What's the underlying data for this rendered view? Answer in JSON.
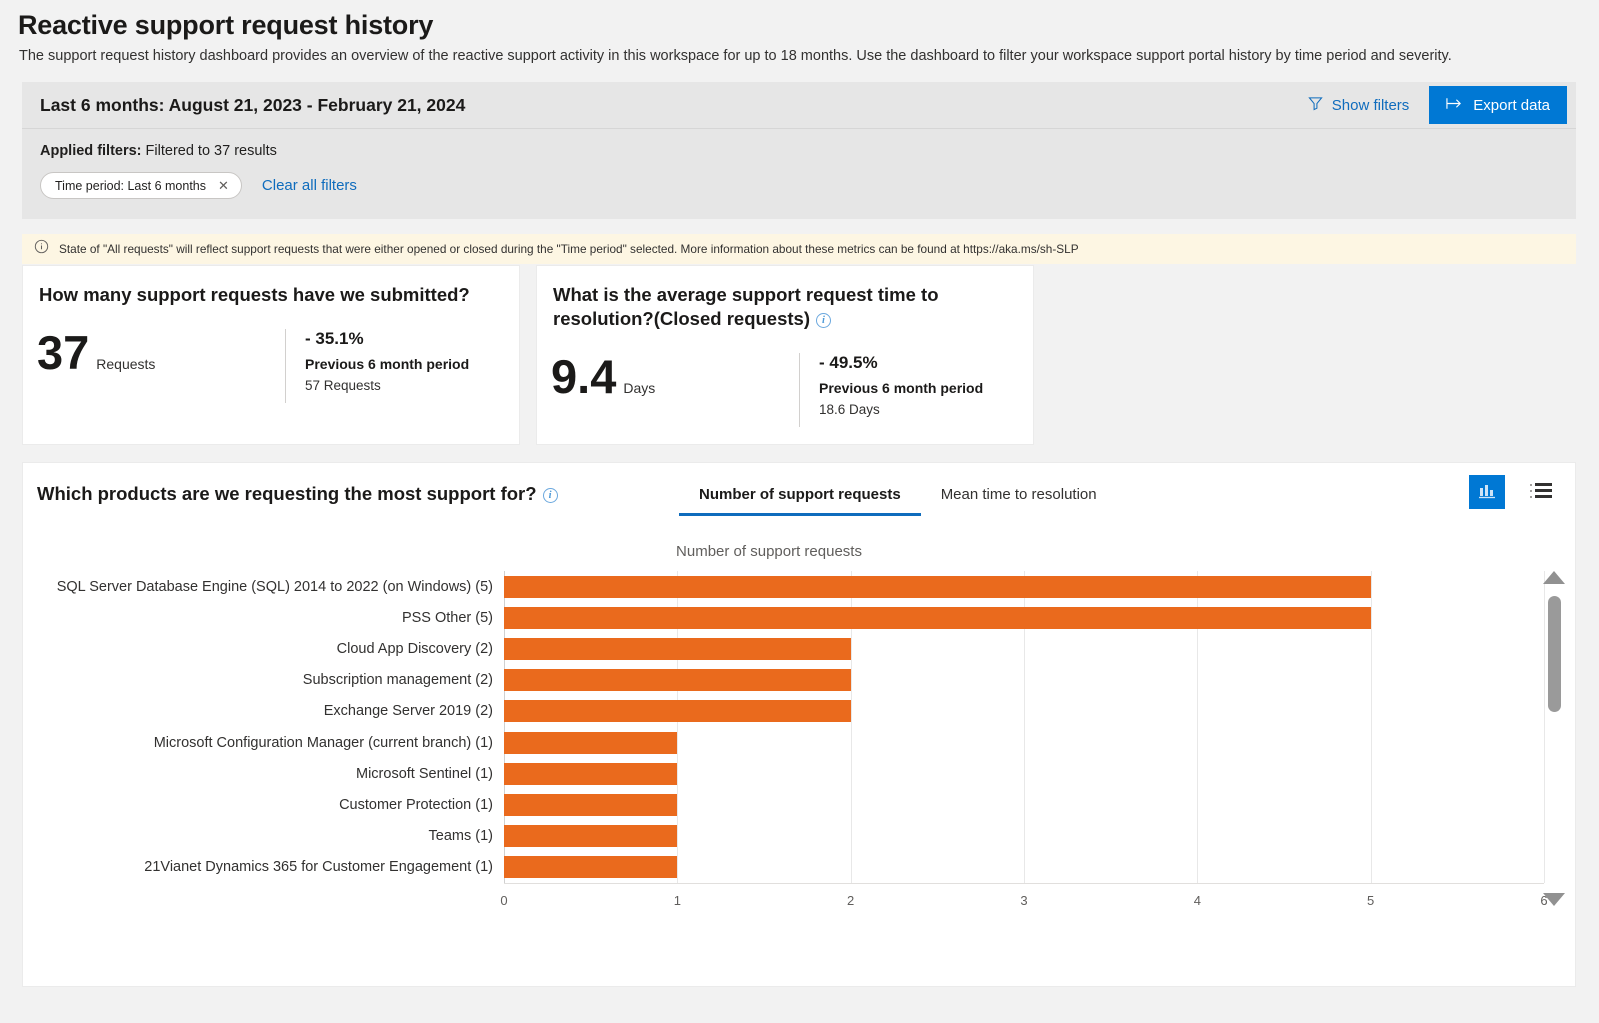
{
  "header": {
    "title": "Reactive support request history",
    "description": "The support request history dashboard provides an overview of the reactive support activity in this workspace for up to 18 months. Use the dashboard to filter your workspace support portal history by time period and severity."
  },
  "filter_bar": {
    "range_title": "Last 6 months: August 21, 2023 - February 21, 2024",
    "show_filters_label": "Show filters",
    "show_filters_icon": "funnel-icon",
    "export_label": "Export data",
    "export_icon": "export-arrow-icon",
    "applied_label": "Applied filters:",
    "applied_value": "Filtered to 37 results",
    "chips": [
      {
        "label": "Time period: Last 6 months",
        "remove_icon": "close-icon"
      }
    ],
    "clear_all_label": "Clear all filters"
  },
  "banner": {
    "icon": "info-icon",
    "text": "State of \"All requests\" will reflect support requests that were either opened or closed during the \"Time period\" selected. More information about these metrics can be found at https://aka.ms/sh-SLP"
  },
  "kpi_cards": [
    {
      "title": "How many support requests have we submitted?",
      "value": "37",
      "unit": "Requests",
      "delta": "- 35.1%",
      "previous_label": "Previous 6 month period",
      "previous_value": "57 Requests",
      "has_info_icon": false
    },
    {
      "title": "What is the average support request time to resolution?(Closed requests)",
      "value": "9.4",
      "unit": "Days",
      "delta": "- 49.5%",
      "previous_label": "Previous 6 month period",
      "previous_value": "18.6 Days",
      "has_info_icon": true,
      "info_icon": "info-icon"
    }
  ],
  "chart_card": {
    "question": "Which products are we requesting the most support for?",
    "question_info_icon": "info-icon",
    "tabs": [
      {
        "label": "Number of support requests",
        "active": true
      },
      {
        "label": "Mean time to resolution",
        "active": false
      }
    ],
    "view_toggle": [
      {
        "icon": "bar-chart-icon",
        "active": true
      },
      {
        "icon": "list-view-icon",
        "active": false
      }
    ],
    "scrollbar": {
      "up_icon": "triangle-up-icon",
      "down_icon": "triangle-down-icon"
    }
  },
  "chart_data": {
    "type": "bar",
    "orientation": "horizontal",
    "title": "Number of support requests",
    "xlabel": "",
    "ylabel": "",
    "xlim": [
      0,
      6
    ],
    "xticks": [
      "0",
      "1",
      "2",
      "3",
      "4",
      "5",
      "6"
    ],
    "grid": true,
    "legend": "none",
    "bar_color": "#ea6a1d",
    "categories": [
      "SQL Server  Database Engine (SQL)  2014 to 2022 (on Windows) (5)",
      "PSS Other (5)",
      "Cloud App Discovery (2)",
      "Subscription management (2)",
      "Exchange Server 2019 (2)",
      "Microsoft Configuration Manager (current branch) (1)",
      "Microsoft Sentinel (1)",
      "Customer Protection (1)",
      "Teams (1)",
      "21Vianet Dynamics 365 for Customer Engagement (1)"
    ],
    "values": [
      5,
      5,
      2,
      2,
      2,
      1,
      1,
      1,
      1,
      1
    ]
  },
  "colors": {
    "accent": "#0078d4",
    "link": "#0f6cbd",
    "bar": "#ea6a1d",
    "banner_bg": "#fdf6e3"
  }
}
